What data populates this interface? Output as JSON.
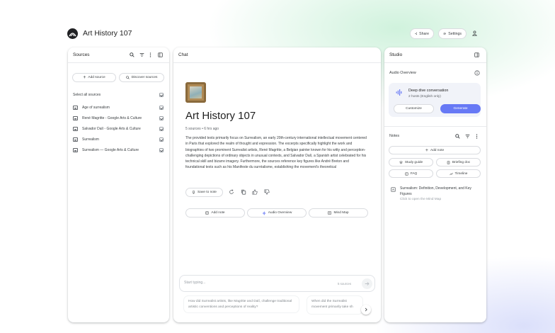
{
  "app": {
    "title": "Art History 107",
    "share_label": "Share",
    "settings_label": "Settings"
  },
  "sources_panel": {
    "title": "Sources",
    "add_source_label": "Add source",
    "discover_label": "Discover sources",
    "select_all_label": "Select all sources",
    "items": [
      {
        "label": "Age of surrealism"
      },
      {
        "label": "René Magritte - Google Arts & Culture"
      },
      {
        "label": "Salvador Dalí - Google Arts & Culture"
      },
      {
        "label": "Surrealism"
      },
      {
        "label": "Surrealism — Google Arts & Culture"
      }
    ]
  },
  "chat_panel": {
    "title": "Chat",
    "notebook_title": "Art History 107",
    "meta": "5 sources • 6 hrs ago",
    "summary": "The provided texts primarily focus on Surrealism, an early 20th-century international intellectual movement centered in Paris that explored the realm of thought and expression. The excerpts specifically highlight the work and biographies of two prominent Surrealist artists, René Magritte, a Belgian painter known for his witty and perception-challenging depictions of ordinary objects in unusual contexts, and Salvador Dalí, a Spanish artist celebrated for his technical skill and bizarre imagery. Furthermore, the sources reference key figures like André Breton and foundational texts such as his Manifeste du surréalisme, establishing the movement's theoretical",
    "save_to_note_label": "Save to note",
    "actions": {
      "add_note": "Add note",
      "audio_overview": "Audio Overview",
      "mind_map": "Mind Map"
    },
    "input_placeholder": "Start typing...",
    "source_count": "5 sources",
    "suggestions": [
      "How did Surrealist artists, like Magritte and Dalí, challenge traditional artistic conventions and perceptions of reality?",
      "When did the Surrealist movement primarily take sh"
    ]
  },
  "studio_panel": {
    "title": "Studio",
    "audio_overview_label": "Audio Overview",
    "audio_card": {
      "title": "Deep dive conversation",
      "subtitle": "2 hosts (English only)",
      "customize_label": "Customize",
      "generate_label": "Generate"
    },
    "notes_label": "Notes",
    "add_note_label": "Add note",
    "note_buttons": {
      "study_guide": "Study guide",
      "briefing_doc": "Briefing doc",
      "faq": "FAQ",
      "timeline": "Timeline"
    },
    "mind_map_note": {
      "title": "Surrealism: Definition, Development, and Key Figures",
      "subtitle": "Click to open the Mind Map"
    }
  },
  "colors": {
    "accent": "#6779f5",
    "border": "#dadce0",
    "text": "#1f1f1f",
    "muted": "#5f6368"
  },
  "icons": [
    "logo-icon",
    "share-icon",
    "gear-icon",
    "account-icon",
    "search-icon",
    "filter-icon",
    "more-icon",
    "panel-icon",
    "plus-icon",
    "discover-icon",
    "document-icon",
    "checkbox-icon",
    "pin-icon",
    "copy-icon",
    "thumb-up-icon",
    "thumb-down-icon",
    "note-icon",
    "audio-icon",
    "mind-map-icon",
    "send-icon",
    "chevron-right-icon",
    "info-icon",
    "waveform-icon",
    "study-guide-icon",
    "briefing-icon",
    "faq-icon",
    "timeline-icon"
  ]
}
